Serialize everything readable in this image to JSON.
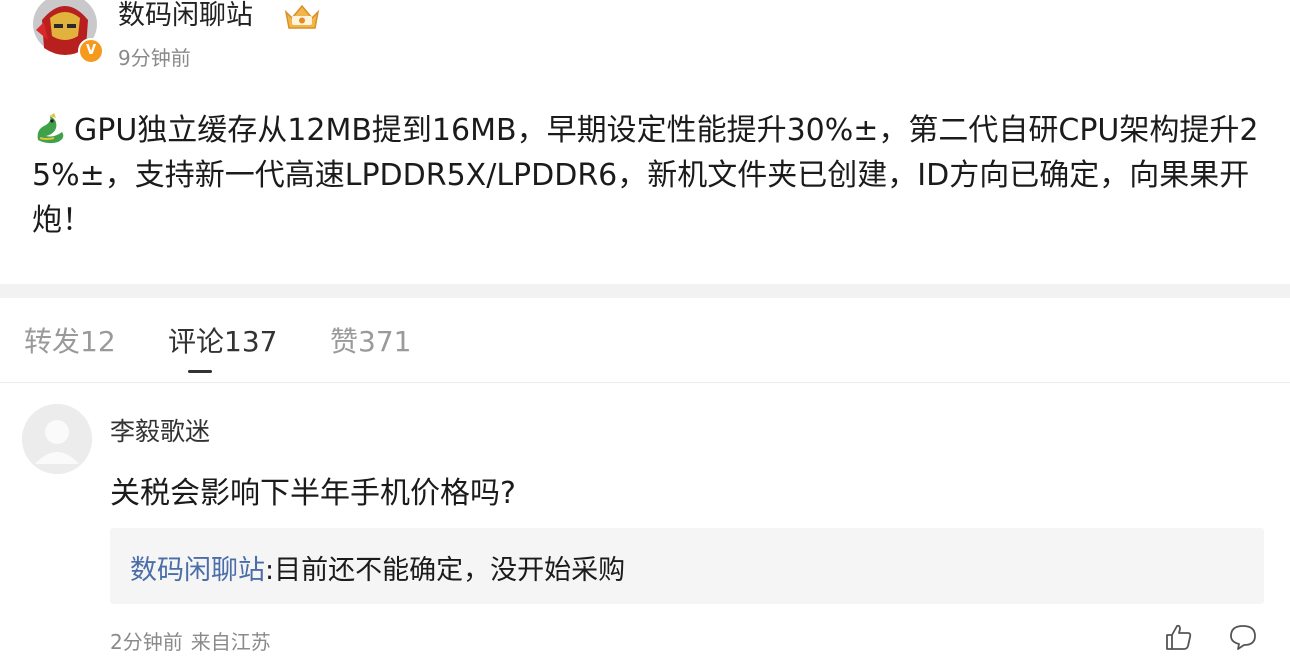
{
  "post": {
    "username": "数码闲聊站",
    "time": "9分钟前",
    "text": "GPU独立缓存从12MB提到16MB，早期设定性能提升30%±，第二代自研CPU架构提升25%±，支持新一代高速LPDDR5X/LPDDR6，新机文件夹已创建，ID方向已确定，向果果开炮！",
    "verified_mark": "V",
    "emoji": "dragon-emoji"
  },
  "tabs": {
    "repost": "转发12",
    "comments": "评论137",
    "likes": "赞371"
  },
  "comment": {
    "author": "李毅歌迷",
    "text": "关税会影响下半年手机价格吗?",
    "reply_author": "数码闲聊站",
    "reply_sep": ":",
    "reply_text": "目前还不能确定，没开始采购",
    "time": "2分钟前",
    "source": "来自江苏"
  },
  "colors": {
    "link": "#4c6ea8",
    "verified": "#f59a1d",
    "muted": "#8a8a8a"
  }
}
